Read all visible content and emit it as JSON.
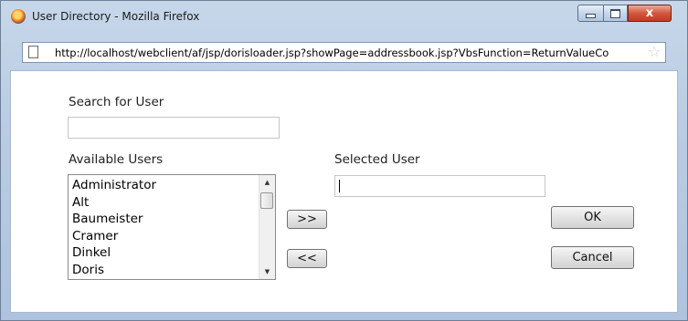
{
  "window": {
    "title": "User Directory - Mozilla Firefox",
    "close_glyph": "x",
    "icons": [
      "firefox-logo-icon",
      "minimize-icon",
      "maximize-icon",
      "close-icon"
    ]
  },
  "addressbar": {
    "url": "http://localhost/webclient/af/jsp/dorisloader.jsp?showPage=addressbook.jsp?VbsFunction=ReturnValueCo",
    "icons": [
      "page-icon",
      "star-icon"
    ]
  },
  "search": {
    "label": "Search for User",
    "value": ""
  },
  "available": {
    "label": "Available Users",
    "items": [
      "Administrator",
      "Alt",
      "Baumeister",
      "Cramer",
      "Dinkel",
      "Doris"
    ]
  },
  "selected": {
    "label": "Selected User",
    "value": ""
  },
  "buttons": {
    "add": ">>",
    "remove": "<<",
    "ok": "OK",
    "cancel": "Cancel"
  },
  "colors": {
    "window_frame": "#b9cce3",
    "close_button": "#c33a20"
  }
}
